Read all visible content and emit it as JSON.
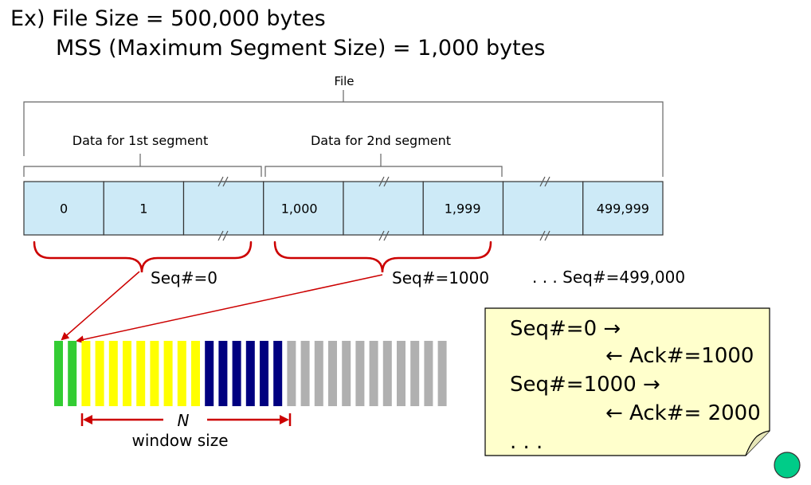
{
  "heading": {
    "line1": "Ex) File Size = 500,000 bytes",
    "line2": "MSS (Maximum Segment Size) = 1,000 bytes"
  },
  "file_diagram": {
    "file_label": "File",
    "segment1_label": "Data for 1st segment",
    "segment2_label": "Data for 2nd segment",
    "cells": [
      "0",
      "1",
      "",
      "1,000",
      "",
      "1,999",
      "",
      "499,999"
    ],
    "cell_fill": "#cdeaf7",
    "seq_labels": [
      "Seq#=0",
      "Seq#=1000",
      ". . . Seq#=499,000"
    ],
    "brace_color": "#cc0000"
  },
  "window": {
    "n_label": "N",
    "size_label": "window size",
    "bars": [
      {
        "color": "#33cc33",
        "count": 2
      },
      {
        "color": "#ffff00",
        "count": 9
      },
      {
        "color": "#000080",
        "count": 6
      },
      {
        "color": "#b0b0b0",
        "count": 12
      }
    ]
  },
  "note": {
    "lines": [
      "Seq#=0 →",
      "← Ack#=1000",
      "Seq#=1000 →",
      "← Ack#= 2000",
      ". . ."
    ],
    "fill": "#ffffcc"
  },
  "colors": {
    "arrow": "#cc0000",
    "nav_button": "#00cc88"
  }
}
